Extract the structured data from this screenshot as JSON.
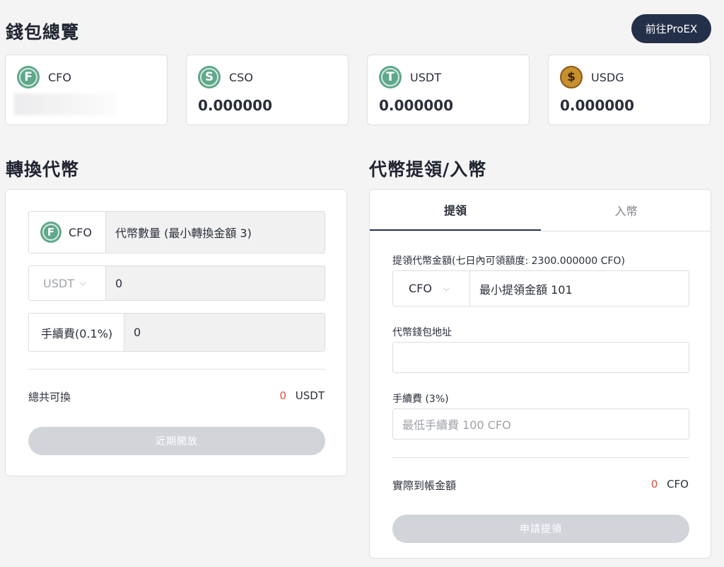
{
  "wallet": {
    "title": "錢包總覽",
    "proex_button": "前往ProEX",
    "coins": [
      {
        "name": "CFO",
        "balance": "",
        "icon": "cfo-coin-icon",
        "color": "#5fa88a"
      },
      {
        "name": "CSO",
        "balance": "0.000000",
        "icon": "cso-coin-icon",
        "color": "#5fa88a"
      },
      {
        "name": "USDT",
        "balance": "0.000000",
        "icon": "usdt-coin-icon",
        "color": "#5fa88a"
      },
      {
        "name": "USDG",
        "balance": "0.000000",
        "icon": "usdg-coin-icon",
        "color": "#c8902e"
      }
    ]
  },
  "convert": {
    "title": "轉換代幣",
    "from_coin": "CFO",
    "amount_placeholder": "代幣數量 (最小轉換金額 3)",
    "to_coin": "USDT",
    "to_value": "0",
    "fee_label": "手續費(0.1%)",
    "fee_value": "0",
    "total_label": "總共可換",
    "total_value": "0",
    "total_unit": "USDT",
    "button": "近期開放"
  },
  "withdraw": {
    "title": "代幣提領/入幣",
    "tabs": [
      "提領",
      "入幣"
    ],
    "active_tab": 0,
    "amount_label": "提領代幣金額(七日內可領額度: 2300.000000 CFO)",
    "coin": "CFO",
    "amount_placeholder": "最小提領金額 101",
    "address_label": "代幣錢包地址",
    "address_value": "",
    "fee_label": "手續費 (3%)",
    "fee_placeholder": "最低手續費 100 CFO",
    "actual_label": "實際到帳金額",
    "actual_value": "0",
    "actual_unit": "CFO",
    "button": "申請提領"
  },
  "colors": {
    "accent": "#243049",
    "coin_green": "#5fa88a",
    "coin_gold": "#c8902e",
    "zero_red": "#d9503d",
    "disabled_button": "#d1d4d9"
  }
}
